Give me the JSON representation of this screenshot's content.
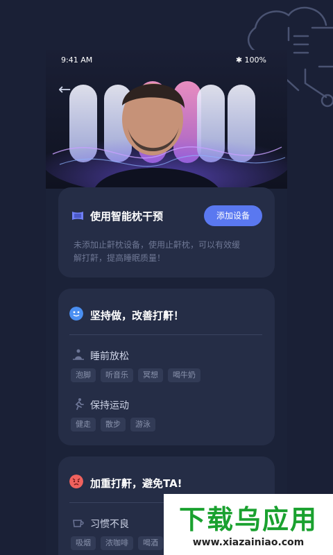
{
  "status_bar": {
    "time": "9:41 AM",
    "battery": "✱ 100%"
  },
  "nav": {
    "back_icon": "arrow-left-icon"
  },
  "hero": {
    "image": "man-sleeping-on-smart-pillow"
  },
  "device_card": {
    "title": "使用智能枕干预",
    "button": "添加设备",
    "description": "未添加止鼾枕设备，使用止鼾枕，可以有效缓解打鼾，提高睡眠质量！"
  },
  "improve_card": {
    "title": "坚持做，改善打鼾！",
    "sections": [
      {
        "label": "睡前放松",
        "icon": "meditation-icon",
        "tags": [
          "泡脚",
          "听音乐",
          "冥想",
          "喝牛奶"
        ]
      },
      {
        "label": "保持运动",
        "icon": "running-icon",
        "tags": [
          "健走",
          "散步",
          "游泳"
        ]
      }
    ]
  },
  "worse_card": {
    "title": "加重打鼾，避免TA!",
    "sections": [
      {
        "label": "习惯不良",
        "icon": "cup-icon",
        "tags": [
          "吸烟",
          "浓咖啡",
          "喝酒"
        ]
      }
    ]
  },
  "watermark": {
    "main": "下载乌应用",
    "url": "www.xiazainiao.com"
  },
  "colors": {
    "background": "#1a2036",
    "card": "#252d46",
    "accent": "#5a78f0",
    "tag": "#323b56"
  }
}
